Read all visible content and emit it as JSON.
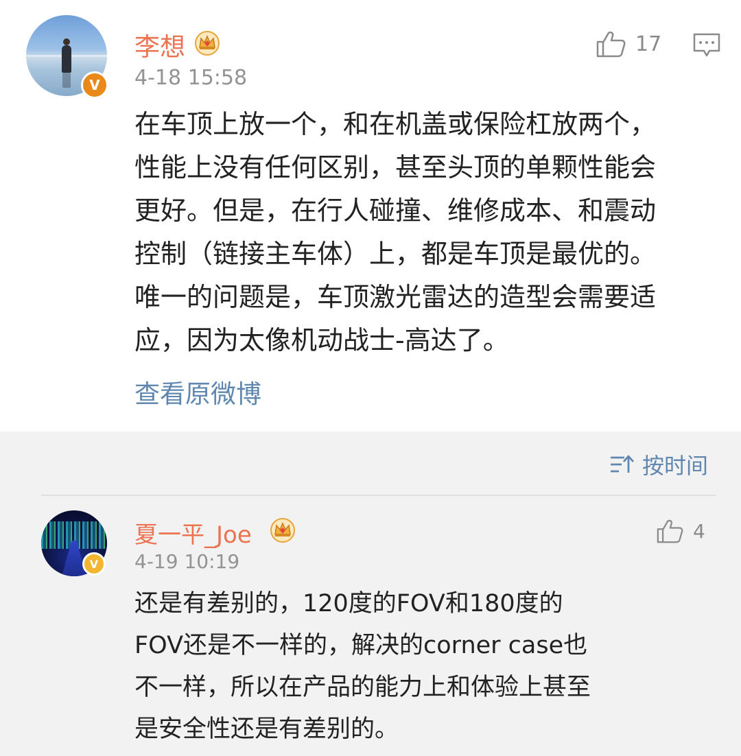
{
  "post": {
    "author": "李想",
    "time": "4-18 15:58",
    "like_count": "17",
    "lines": [
      "在车顶上放一个，和在机盖或保险杠放两个，",
      "性能上没有任何区别，甚至头顶的单颗性能会",
      "更好。但是，在行人碰撞、维修成本、和震动",
      "控制（链接主车体）上，都是车顶是最优的。",
      "唯一的问题是，车顶激光雷达的造型会需要适",
      "应，因为太像机动战士-高达了。"
    ],
    "view_original": "查看原微博"
  },
  "sort": {
    "label": "按时间"
  },
  "reply": {
    "author": "夏一平_Joe",
    "time": "4-19 10:19",
    "like_count": "4",
    "lines": [
      "还是有差别的，120度的FOV和180度的",
      "FOV还是不一样的，解决的corner case也",
      "不一样，所以在产品的能力上和体验上甚至",
      "是安全性还是有差别的。"
    ]
  },
  "badges": {
    "verified_glyph": "V"
  },
  "colors": {
    "name": "#eb7350",
    "link": "#5f87b0",
    "timestamp": "#939393",
    "comments_bg": "#f2f2f2",
    "verified": "#e8891a"
  },
  "icons": [
    "thumbs-up-icon",
    "comment-icon",
    "crown-icon",
    "sort-icon",
    "verified-icon"
  ]
}
